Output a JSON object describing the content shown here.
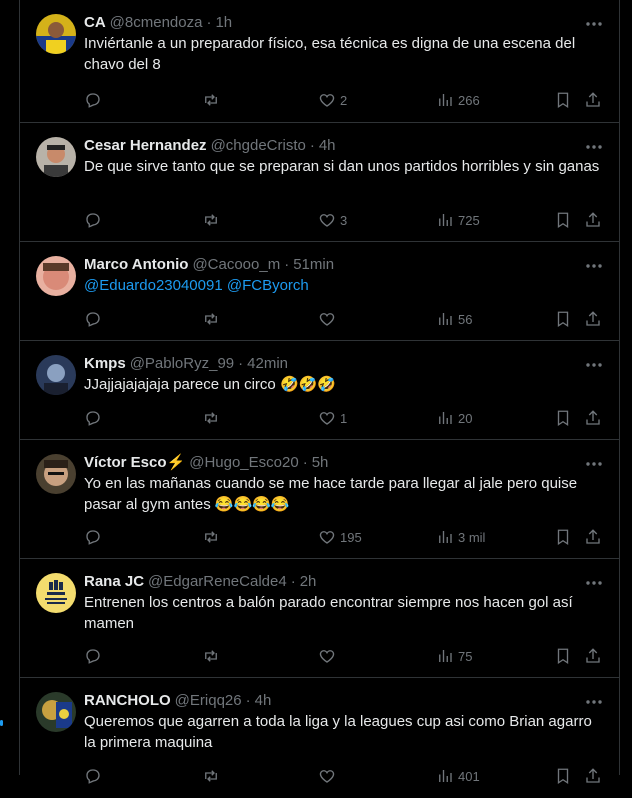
{
  "colors": {
    "background": "#000000",
    "text": "#e7e9ea",
    "muted": "#71767b",
    "link": "#1d9bf0",
    "divider": "#2f3336"
  },
  "tweets": [
    {
      "name": "CA",
      "handle": "@8cmendoza",
      "time": "1h",
      "text": "Inviértanle a un preparador físico, esa técnica es digna de una escena del chavo del 8",
      "replies": "",
      "retweets": "",
      "likes": "2",
      "views": "266"
    },
    {
      "name": "Cesar Hernandez",
      "handle": "@chgdeCristo",
      "time": "4h",
      "text": "De que sirve tanto que se preparan si dan unos partidos horribles y sin ganas",
      "replies": "",
      "retweets": "",
      "likes": "3",
      "views": "725"
    },
    {
      "name": "Marco Antonio",
      "handle": "@Cacooo_m",
      "time": "51min",
      "mention1": "@Eduardo23040091",
      "mention2": "@FCByorch",
      "replies": "",
      "retweets": "",
      "likes": "",
      "views": "56"
    },
    {
      "name": "Kmps",
      "handle": "@PabloRyz_99",
      "time": "42min",
      "text": "JJajjajajajaja parece un circo",
      "emoji": "🤣🤣🤣",
      "replies": "",
      "retweets": "",
      "likes": "1",
      "views": "20"
    },
    {
      "name": "Víctor Esco",
      "badge": "⚡",
      "handle": "@Hugo_Esco20",
      "time": "5h",
      "text": "Yo en las mañanas cuando se me hace tarde para llegar al jale pero quise pasar al gym antes",
      "emoji": "😂😂😂😂",
      "replies": "",
      "retweets": "",
      "likes": "195",
      "views": "3 mil"
    },
    {
      "name": "Rana JC",
      "handle": "@EdgarReneCalde4",
      "time": "2h",
      "text": "Entrenen los centros a balón parado encontrar siempre nos hacen gol así mamen",
      "replies": "",
      "retweets": "",
      "likes": "",
      "views": "75"
    },
    {
      "name": "RANCHOLO",
      "handle": "@Eriqq26",
      "time": "4h",
      "text": "Queremos que agarren a toda la liga y la leagues cup asi como Brian agarro la primera maquina",
      "replies": "",
      "retweets": "",
      "likes": "",
      "views": "401"
    }
  ]
}
